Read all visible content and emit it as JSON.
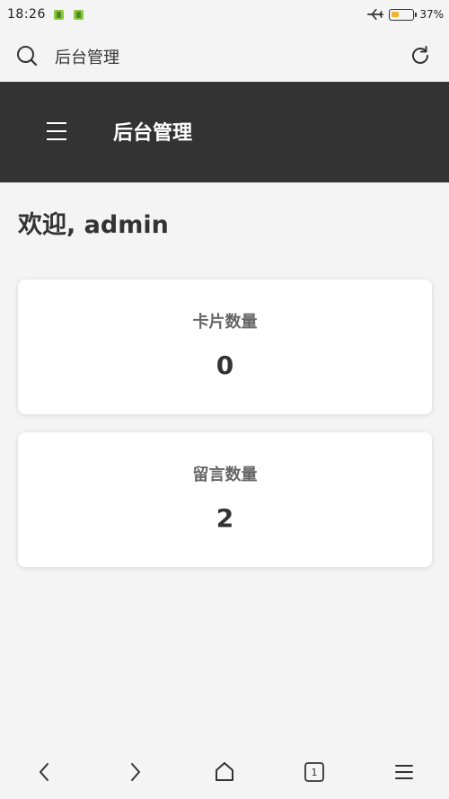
{
  "status_bar": {
    "time": "18:26",
    "battery_percent": "37%",
    "battery_level": 0.37,
    "notification_icons": [
      "app-notification-icon",
      "app-notification-icon"
    ],
    "mode_icon": "airplane-icon"
  },
  "browser": {
    "address_title": "后台管理",
    "search_icon": "search-icon",
    "reload_icon": "reload-icon",
    "open_tabs": "1"
  },
  "header": {
    "menu_icon": "hamburger-menu-icon",
    "title": "后台管理"
  },
  "main": {
    "welcome": "欢迎, admin",
    "cards": [
      {
        "label": "卡片数量",
        "value": "0"
      },
      {
        "label": "留言数量",
        "value": "2"
      }
    ]
  },
  "bottom_nav": {
    "icons": [
      "back-icon",
      "forward-icon",
      "home-icon",
      "tabs-icon",
      "menu-icon"
    ]
  },
  "colors": {
    "header_bg": "#333333",
    "page_bg": "#f4f4f4",
    "card_bg": "#ffffff",
    "battery_fill": "#f2b233"
  }
}
